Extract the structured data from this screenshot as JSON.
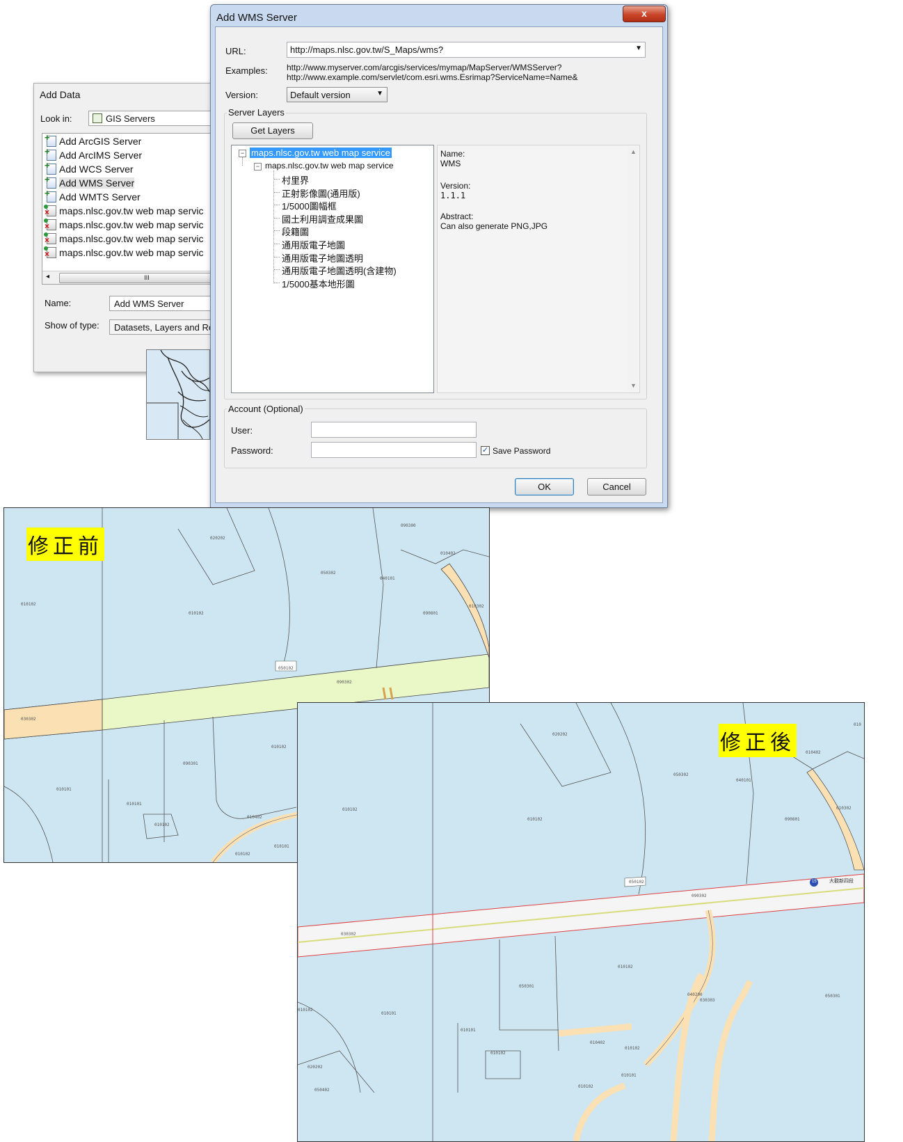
{
  "add_data": {
    "title": "Add Data",
    "look_in_label": "Look in:",
    "look_in_value": "GIS Servers",
    "items": [
      {
        "label": "Add ArcGIS Server",
        "icon": "add-server-icon"
      },
      {
        "label": "Add ArcIMS Server",
        "icon": "add-server-icon"
      },
      {
        "label": "Add WCS Server",
        "icon": "add-server-icon"
      },
      {
        "label": "Add WMS Server",
        "icon": "add-server-icon"
      },
      {
        "label": "Add WMTS Server",
        "icon": "add-server-icon"
      },
      {
        "label": "maps.nlsc.gov.tw web map servic",
        "icon": "wms-connection-icon"
      },
      {
        "label": "maps.nlsc.gov.tw web map servic",
        "icon": "wms-connection-icon"
      },
      {
        "label": "maps.nlsc.gov.tw web map servic",
        "icon": "wms-connection-icon"
      },
      {
        "label": "maps.nlsc.gov.tw web map servic",
        "icon": "wms-connection-icon"
      }
    ],
    "scroll_thumb": "III",
    "name_label": "Name:",
    "name_value": "Add WMS Server",
    "type_label": "Show of type:",
    "type_value": "Datasets, Layers and Re"
  },
  "wms_dialog": {
    "title": "Add WMS Server",
    "close": "x",
    "url_label": "URL:",
    "url_value": "http://maps.nlsc.gov.tw/S_Maps/wms?",
    "examples_label": "Examples:",
    "example_1": "http://www.myserver.com/arcgis/services/mymap/MapServer/WMSServer?",
    "example_2": "http://www.example.com/servlet/com.esri.wms.Esrimap?ServiceName=Name&",
    "version_label": "Version:",
    "version_value": "Default version",
    "server_layers_label": "Server Layers",
    "get_layers": "Get Layers",
    "tree": {
      "root": "maps.nlsc.gov.tw web map service",
      "child": "maps.nlsc.gov.tw web map service",
      "layers": [
        "村里界",
        "正射影像圖(通用版)",
        "1/5000圖幅框",
        "國土利用調查成果圖",
        "段籍圖",
        "通用版電子地圖",
        "通用版電子地圖透明",
        "通用版電子地圖透明(含建物)",
        "1/5000基本地形圖"
      ]
    },
    "info": {
      "name_label": "Name:",
      "name_value": "WMS",
      "version_label": "Version:",
      "version_value": "1.1.1",
      "abstract_label": "Abstract:",
      "abstract_value": "Can also generate PNG,JPG"
    },
    "account_label": "Account (Optional)",
    "user_label": "User:",
    "password_label": "Password:",
    "save_password": "Save Password",
    "save_password_checked": true,
    "ok": "OK",
    "cancel": "Cancel"
  },
  "map_before": {
    "badge": "修正前",
    "labels": [
      "020202",
      "090300",
      "010402",
      "050302",
      "040101",
      "010102",
      "010102",
      "090801",
      "010302",
      "050102",
      "090302",
      "030302",
      "010102",
      "090301",
      "010101",
      "010101",
      "010402",
      "010102",
      "010101",
      "010102"
    ]
  },
  "map_after": {
    "badge": "修正後",
    "labels": [
      "020202",
      "010402",
      "050302",
      "040101",
      "010102",
      "010102",
      "090801",
      "010302",
      "050102",
      "090302",
      "030302",
      "010102",
      "050301",
      "040200",
      "030303",
      "050301",
      "010102",
      "010101",
      "010101",
      "010402",
      "010102",
      "010102",
      "010101",
      "020202",
      "050402",
      "010102",
      "010"
    ],
    "road_name": "大觀新四段",
    "road_shield": "15"
  }
}
